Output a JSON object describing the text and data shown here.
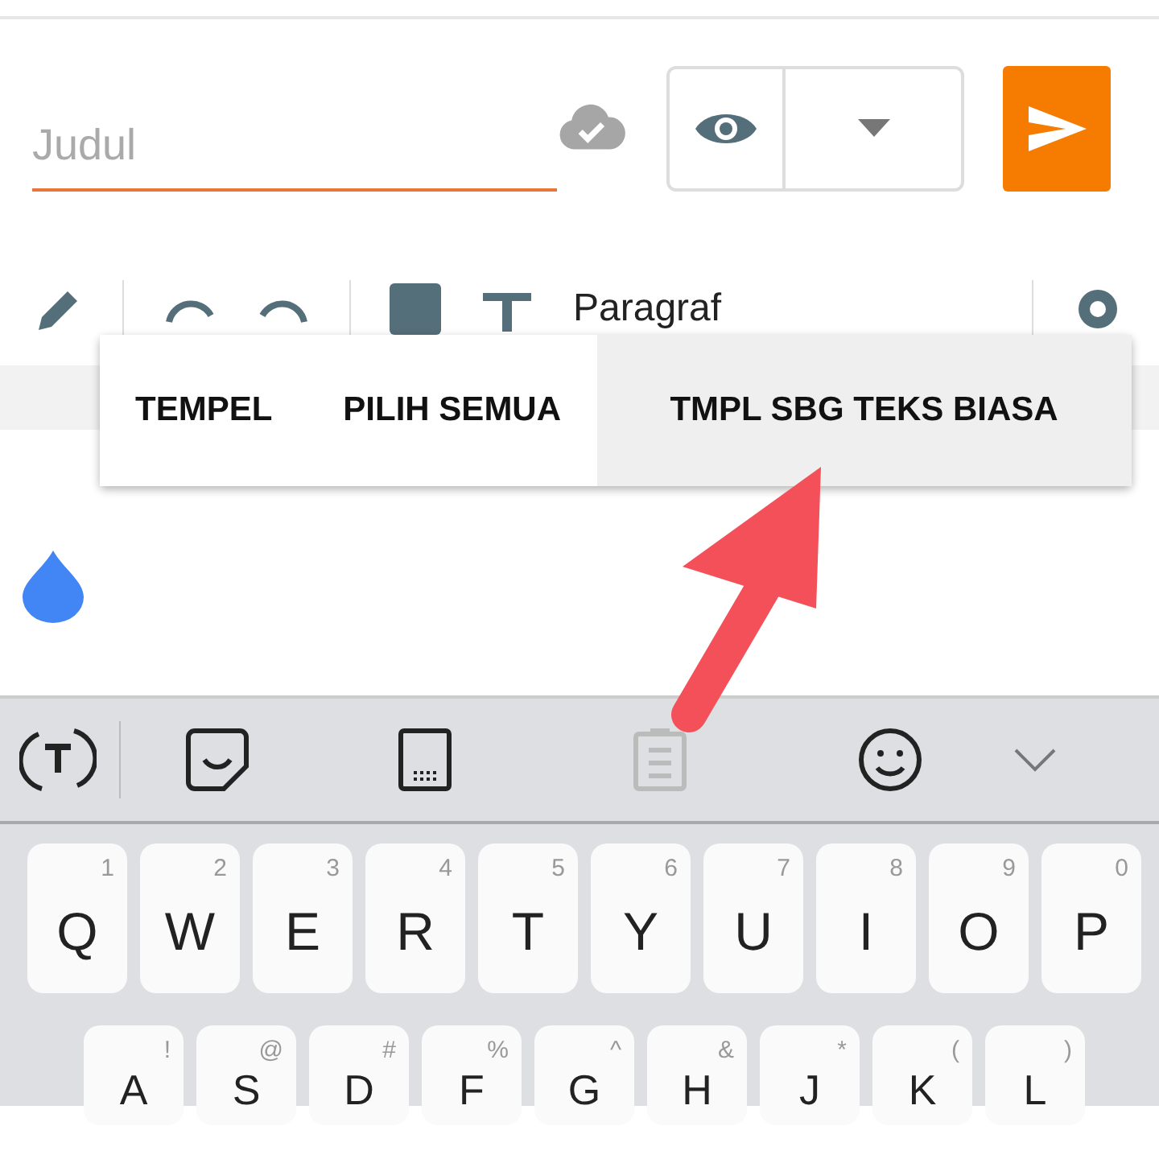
{
  "title_field": {
    "placeholder": "Judul"
  },
  "toolbar": {
    "paragraph_style": "Paragraf"
  },
  "context_menu": [
    {
      "label": "TEMPEL",
      "selected": false
    },
    {
      "label": "PILIH SEMUA",
      "selected": false
    },
    {
      "label": "TMPL SBG TEKS BIASA",
      "selected": true
    }
  ],
  "keyboard": {
    "rows": [
      [
        {
          "letter": "Q",
          "hint": "1"
        },
        {
          "letter": "W",
          "hint": "2"
        },
        {
          "letter": "E",
          "hint": "3"
        },
        {
          "letter": "R",
          "hint": "4"
        },
        {
          "letter": "T",
          "hint": "5"
        },
        {
          "letter": "Y",
          "hint": "6"
        },
        {
          "letter": "U",
          "hint": "7"
        },
        {
          "letter": "I",
          "hint": "8"
        },
        {
          "letter": "O",
          "hint": "9"
        },
        {
          "letter": "P",
          "hint": "0"
        }
      ],
      [
        {
          "letter": "A",
          "hint": "!"
        },
        {
          "letter": "S",
          "hint": "@"
        },
        {
          "letter": "D",
          "hint": "#"
        },
        {
          "letter": "F",
          "hint": "%"
        },
        {
          "letter": "G",
          "hint": "^"
        },
        {
          "letter": "H",
          "hint": "&"
        },
        {
          "letter": "J",
          "hint": "*"
        },
        {
          "letter": "K",
          "hint": "("
        },
        {
          "letter": "L",
          "hint": ")"
        }
      ]
    ]
  }
}
